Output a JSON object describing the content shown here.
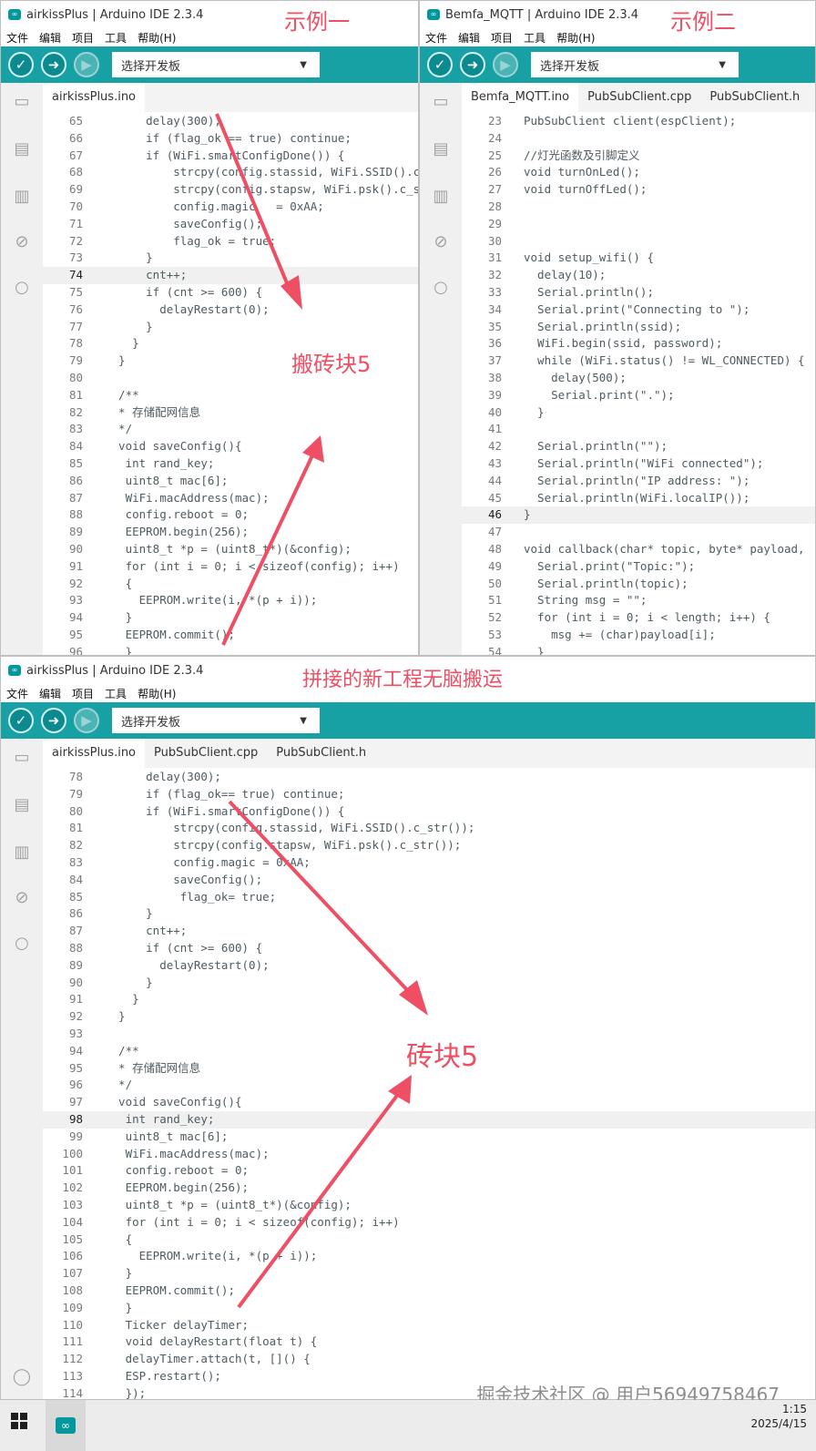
{
  "win1": {
    "title": "airkissPlus | Arduino IDE 2.3.4",
    "board": "选择开发板",
    "tabs": [
      "airkissPlus.ino"
    ],
    "lines": [
      {
        "n": "65",
        "t": "      delay(300);"
      },
      {
        "n": "66",
        "t": "      if (flag_ok == true) continue;"
      },
      {
        "n": "67",
        "t": "      if (WiFi.smartConfigDone()) {"
      },
      {
        "n": "68",
        "t": "          strcpy(config.stassid, WiFi.SSID().c_s"
      },
      {
        "n": "69",
        "t": "          strcpy(config.stapsw, WiFi.psk().c_str"
      },
      {
        "n": "70",
        "t": "          config.magic   = 0xAA;"
      },
      {
        "n": "71",
        "t": "          saveConfig();"
      },
      {
        "n": "72",
        "t": "          flag_ok = true;"
      },
      {
        "n": "73",
        "t": "      }"
      },
      {
        "n": "74",
        "t": "      cnt++;"
      },
      {
        "n": "75",
        "t": "      if (cnt >= 600) {"
      },
      {
        "n": "76",
        "t": "        delayRestart(0);"
      },
      {
        "n": "77",
        "t": "      }"
      },
      {
        "n": "78",
        "t": "    }"
      },
      {
        "n": "79",
        "t": "  }"
      },
      {
        "n": "80",
        "t": ""
      },
      {
        "n": "81",
        "t": "  /**"
      },
      {
        "n": "82",
        "t": "  * 存储配网信息"
      },
      {
        "n": "83",
        "t": "  */"
      },
      {
        "n": "84",
        "t": "  void saveConfig(){"
      },
      {
        "n": "85",
        "t": "   int rand_key;"
      },
      {
        "n": "86",
        "t": "   uint8_t mac[6];"
      },
      {
        "n": "87",
        "t": "   WiFi.macAddress(mac);"
      },
      {
        "n": "88",
        "t": "   config.reboot = 0;"
      },
      {
        "n": "89",
        "t": "   EEPROM.begin(256);"
      },
      {
        "n": "90",
        "t": "   uint8_t *p = (uint8_t*)(&config);"
      },
      {
        "n": "91",
        "t": "   for (int i = 0; i < sizeof(config); i++)"
      },
      {
        "n": "92",
        "t": "   {"
      },
      {
        "n": "93",
        "t": "     EEPROM.write(i, *(p + i));"
      },
      {
        "n": "94",
        "t": "   }"
      },
      {
        "n": "95",
        "t": "   EEPROM.commit();"
      },
      {
        "n": "96",
        "t": "   }"
      }
    ],
    "current_line": "74"
  },
  "win2": {
    "title": "Bemfa_MQTT | Arduino IDE 2.3.4",
    "board": "选择开发板",
    "tabs": [
      "Bemfa_MQTT.ino",
      "PubSubClient.cpp",
      "PubSubClient.h"
    ],
    "lines": [
      {
        "n": "23",
        "t": "PubSubClient client(espClient);"
      },
      {
        "n": "24",
        "t": ""
      },
      {
        "n": "25",
        "t": "//灯光函数及引脚定义"
      },
      {
        "n": "26",
        "t": "void turnOnLed();"
      },
      {
        "n": "27",
        "t": "void turnOffLed();"
      },
      {
        "n": "28",
        "t": ""
      },
      {
        "n": "29",
        "t": ""
      },
      {
        "n": "30",
        "t": ""
      },
      {
        "n": "31",
        "t": "void setup_wifi() {"
      },
      {
        "n": "32",
        "t": "  delay(10);"
      },
      {
        "n": "33",
        "t": "  Serial.println();"
      },
      {
        "n": "34",
        "t": "  Serial.print(\"Connecting to \");"
      },
      {
        "n": "35",
        "t": "  Serial.println(ssid);"
      },
      {
        "n": "36",
        "t": "  WiFi.begin(ssid, password);"
      },
      {
        "n": "37",
        "t": "  while (WiFi.status() != WL_CONNECTED) {"
      },
      {
        "n": "38",
        "t": "    delay(500);"
      },
      {
        "n": "39",
        "t": "    Serial.print(\".\");"
      },
      {
        "n": "40",
        "t": "  }"
      },
      {
        "n": "41",
        "t": ""
      },
      {
        "n": "42",
        "t": "  Serial.println(\"\");"
      },
      {
        "n": "43",
        "t": "  Serial.println(\"WiFi connected\");"
      },
      {
        "n": "44",
        "t": "  Serial.println(\"IP address: \");"
      },
      {
        "n": "45",
        "t": "  Serial.println(WiFi.localIP());"
      },
      {
        "n": "46",
        "t": "}"
      },
      {
        "n": "47",
        "t": ""
      },
      {
        "n": "48",
        "t": "void callback(char* topic, byte* payload,"
      },
      {
        "n": "49",
        "t": "  Serial.print(\"Topic:\");"
      },
      {
        "n": "50",
        "t": "  Serial.println(topic);"
      },
      {
        "n": "51",
        "t": "  String msg = \"\";"
      },
      {
        "n": "52",
        "t": "  for (int i = 0; i < length; i++) {"
      },
      {
        "n": "53",
        "t": "    msg += (char)payload[i];"
      },
      {
        "n": "54",
        "t": "  }"
      }
    ],
    "current_line": "46"
  },
  "win3": {
    "title": "airkissPlus | Arduino IDE 2.3.4",
    "board": "选择开发板",
    "tabs": [
      "airkissPlus.ino",
      "PubSubClient.cpp",
      "PubSubClient.h"
    ],
    "lines": [
      {
        "n": "78",
        "t": "      delay(300);"
      },
      {
        "n": "79",
        "t": "      if (flag_ok== true) continue;"
      },
      {
        "n": "80",
        "t": "      if (WiFi.smartConfigDone()) {"
      },
      {
        "n": "81",
        "t": "          strcpy(config.stassid, WiFi.SSID().c_str());"
      },
      {
        "n": "82",
        "t": "          strcpy(config.stapsw, WiFi.psk().c_str());"
      },
      {
        "n": "83",
        "t": "          config.magic = 0xAA;"
      },
      {
        "n": "84",
        "t": "          saveConfig();"
      },
      {
        "n": "85",
        "t": "           flag_ok= true;"
      },
      {
        "n": "86",
        "t": "      }"
      },
      {
        "n": "87",
        "t": "      cnt++;"
      },
      {
        "n": "88",
        "t": "      if (cnt >= 600) {"
      },
      {
        "n": "89",
        "t": "        delayRestart(0);"
      },
      {
        "n": "90",
        "t": "      }"
      },
      {
        "n": "91",
        "t": "    }"
      },
      {
        "n": "92",
        "t": "  }"
      },
      {
        "n": "93",
        "t": ""
      },
      {
        "n": "94",
        "t": "  /**"
      },
      {
        "n": "95",
        "t": "  * 存储配网信息"
      },
      {
        "n": "96",
        "t": "  */"
      },
      {
        "n": "97",
        "t": "  void saveConfig(){"
      },
      {
        "n": "98",
        "t": "   int rand_key;"
      },
      {
        "n": "99",
        "t": "   uint8_t mac[6];"
      },
      {
        "n": "100",
        "t": "   WiFi.macAddress(mac);"
      },
      {
        "n": "101",
        "t": "   config.reboot = 0;"
      },
      {
        "n": "102",
        "t": "   EEPROM.begin(256);"
      },
      {
        "n": "103",
        "t": "   uint8_t *p = (uint8_t*)(&config);"
      },
      {
        "n": "104",
        "t": "   for (int i = 0; i < sizeof(config); i++)"
      },
      {
        "n": "105",
        "t": "   {"
      },
      {
        "n": "106",
        "t": "     EEPROM.write(i, *(p + i));"
      },
      {
        "n": "107",
        "t": "   }"
      },
      {
        "n": "108",
        "t": "   EEPROM.commit();"
      },
      {
        "n": "109",
        "t": "   }"
      },
      {
        "n": "110",
        "t": "   Ticker delayTimer;"
      },
      {
        "n": "111",
        "t": "   void delayRestart(float t) {"
      },
      {
        "n": "112",
        "t": "   delayTimer.attach(t, []() {"
      },
      {
        "n": "113",
        "t": "   ESP.restart();"
      },
      {
        "n": "114",
        "t": "   });"
      }
    ],
    "current_line": "98"
  },
  "menu": [
    "文件",
    "编辑",
    "项目",
    "工具",
    "帮助(H)"
  ],
  "annotations": {
    "example1": "示例一",
    "example2": "示例二",
    "brick_move": "搬砖块5",
    "combined": "拼接的新工程无脑搬运",
    "brick": "砖块5"
  },
  "watermark": "掘金技术社区 @ 用户56949758467",
  "taskbar": {
    "time": "1:15",
    "date": "2025/4/15"
  },
  "colors": {
    "arduino_teal": "#17a1a5",
    "annotation_red": "#ef4f64"
  }
}
